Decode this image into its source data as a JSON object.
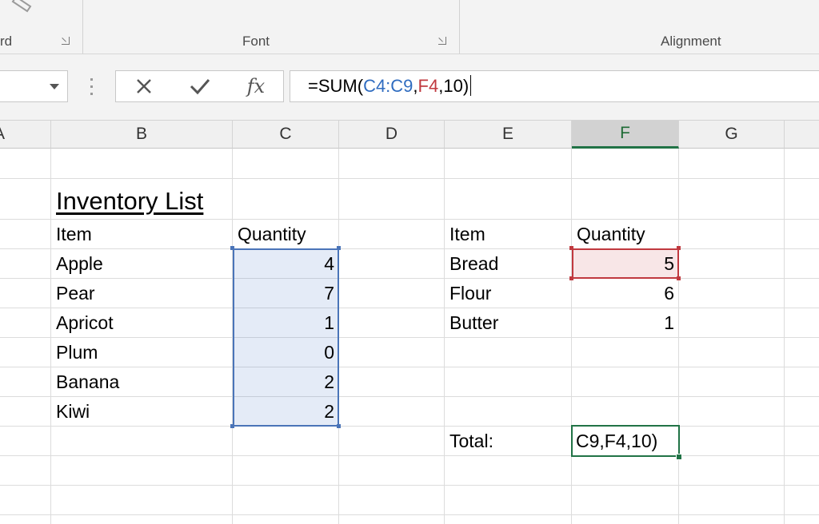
{
  "ribbon": {
    "groups": [
      {
        "name": "clipboard",
        "label": "rd"
      },
      {
        "name": "font",
        "label": "Font"
      },
      {
        "name": "alignment",
        "label": "Alignment"
      }
    ]
  },
  "formula_bar": {
    "cancel_icon": "close-icon",
    "enter_icon": "checkmark-icon",
    "fx_label": "fx",
    "formula_parts": [
      {
        "text": "=SUM(",
        "color": "#000000"
      },
      {
        "text": "C4:C9",
        "color": "#2f6cc0"
      },
      {
        "text": ",",
        "color": "#000000"
      },
      {
        "text": "F4",
        "color": "#c0393f"
      },
      {
        "text": ",10)",
        "color": "#000000"
      }
    ]
  },
  "columns": [
    "A",
    "B",
    "C",
    "D",
    "E",
    "F",
    "G"
  ],
  "active_column": "F",
  "sheet": {
    "title": "Inventory List",
    "left_table": {
      "header": {
        "item": "Item",
        "quantity": "Quantity"
      },
      "rows": [
        {
          "item": "Apple",
          "quantity": "4"
        },
        {
          "item": "Pear",
          "quantity": "7"
        },
        {
          "item": "Apricot",
          "quantity": "1"
        },
        {
          "item": "Plum",
          "quantity": "0"
        },
        {
          "item": "Banana",
          "quantity": "2"
        },
        {
          "item": "Kiwi",
          "quantity": "2"
        }
      ]
    },
    "right_table": {
      "header": {
        "item": "Item",
        "quantity": "Quantity"
      },
      "rows": [
        {
          "item": "Bread",
          "quantity": "5"
        },
        {
          "item": "Flour",
          "quantity": "6"
        },
        {
          "item": "Butter",
          "quantity": "1"
        }
      ]
    },
    "total_label": "Total:",
    "active_cell_text": "C9,F4,10)"
  },
  "colors": {
    "accent_green": "#217346",
    "range_blue": "#4a74b8",
    "range_red": "#c0393f"
  }
}
